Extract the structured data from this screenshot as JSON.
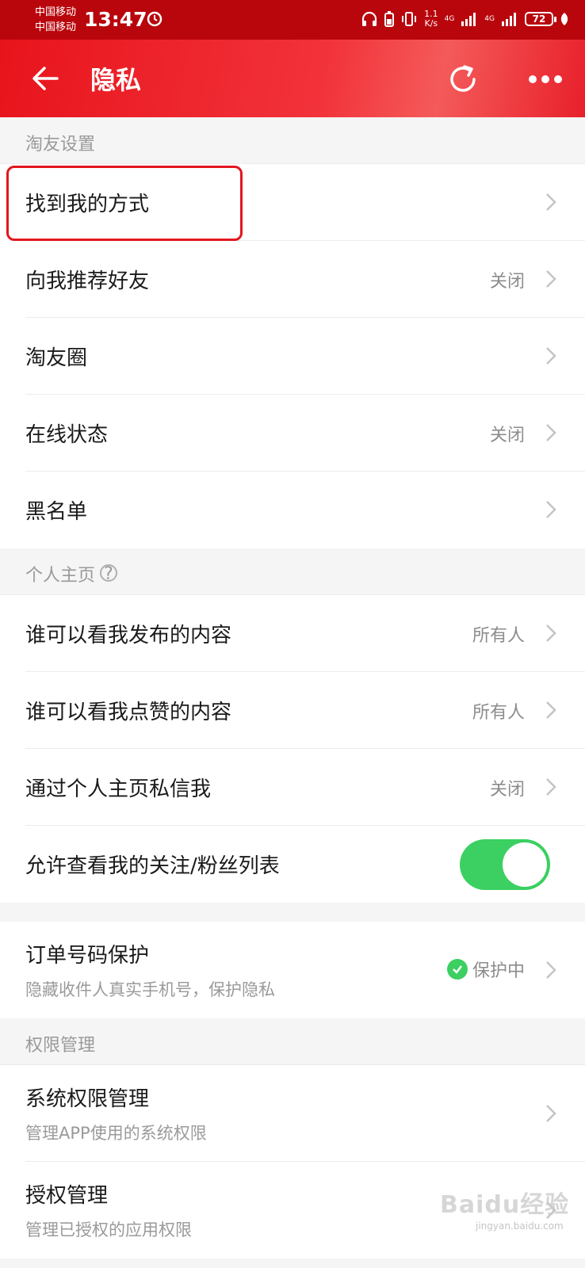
{
  "status_bar": {
    "carrier_1": "中国移动",
    "carrier_2": "中国移动",
    "time": "13:47",
    "net_speed_value": "1.1",
    "net_speed_unit": "K/s",
    "signal_1": "4G",
    "signal_2": "4G",
    "battery": "72"
  },
  "nav": {
    "title": "隐私",
    "back_icon": "arrow-left-icon",
    "refresh_icon": "refresh-icon",
    "more_icon": "more-dots-icon"
  },
  "sections": {
    "friends_header": "淘友设置",
    "profile_header": "个人主页",
    "permissions_header": "权限管理"
  },
  "friends_rows": [
    {
      "label": "找到我的方式",
      "value": ""
    },
    {
      "label": "向我推荐好友",
      "value": "关闭"
    },
    {
      "label": "淘友圈",
      "value": ""
    },
    {
      "label": "在线状态",
      "value": "关闭"
    },
    {
      "label": "黑名单",
      "value": ""
    }
  ],
  "profile_rows": [
    {
      "label": "谁可以看我发布的内容",
      "value": "所有人"
    },
    {
      "label": "谁可以看我点赞的内容",
      "value": "所有人"
    },
    {
      "label": "通过个人主页私信我",
      "value": "关闭"
    },
    {
      "label": "允许查看我的关注/粉丝列表",
      "toggle_on": true
    }
  ],
  "order_protection": {
    "label": "订单号码保护",
    "subtitle": "隐藏收件人真实手机号，保护隐私",
    "status": "保护中"
  },
  "permission_rows": [
    {
      "label": "系统权限管理",
      "subtitle": "管理APP使用的系统权限"
    },
    {
      "label": "授权管理",
      "subtitle": "管理已授权的应用权限"
    }
  ],
  "watermark": {
    "brand": "Baidu经验",
    "url": "jingyan.baidu.com"
  },
  "colors": {
    "brand_red": "#e8141c",
    "status_bar": "#b8060c",
    "toggle_green": "#3bd061",
    "highlight_red": "#e3161e"
  }
}
